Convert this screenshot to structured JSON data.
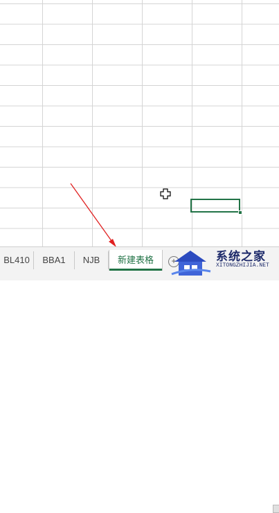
{
  "sheet_tabs": [
    {
      "label": "BL410",
      "active": false
    },
    {
      "label": "BBA1",
      "active": false
    },
    {
      "label": "NJB",
      "active": false
    },
    {
      "label": "新建表格",
      "active": true
    }
  ],
  "add_sheet_label": "+",
  "watermark": {
    "title": "系统之家",
    "subtitle": "XITONGZHIJIA.NET"
  },
  "colors": {
    "accent": "#217346",
    "annotation_arrow": "#e02020",
    "watermark": "#1d2a6a"
  },
  "icons": {
    "cursor": "excel-cross-cursor",
    "annotation": "red-arrow"
  }
}
